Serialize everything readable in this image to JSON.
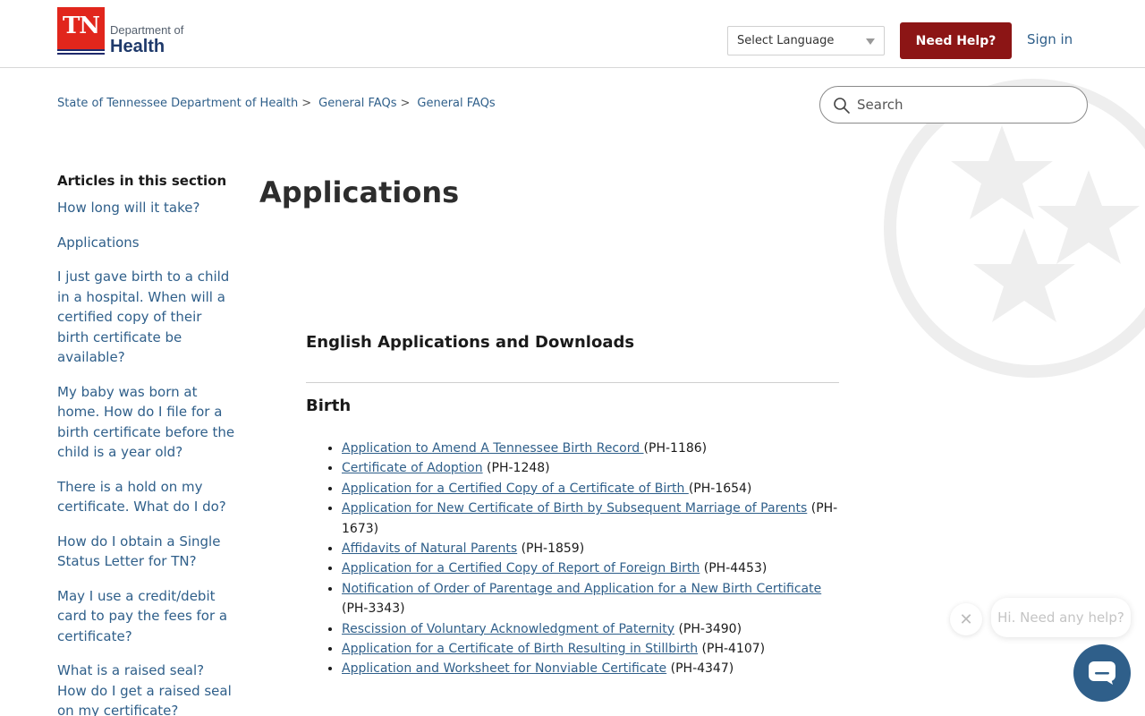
{
  "header": {
    "logo_tn": "TN",
    "logo_dept": "Department of",
    "logo_health": "Health",
    "language_select": "Select Language",
    "need_help": "Need Help?",
    "sign_in": "Sign in"
  },
  "breadcrumb": {
    "items": [
      "State of Tennessee Department of Health",
      "General FAQs",
      "General FAQs"
    ],
    "separator": ">"
  },
  "search": {
    "placeholder": "Search"
  },
  "sidebar": {
    "heading": "Articles in this section",
    "items": [
      "How long will it take?",
      "Applications",
      "I just gave birth to a child in a hospital. When will a certified copy of their birth certificate be available?",
      "My baby was born at home. How do I file for a birth certificate before the child is a year old?",
      "There is a hold on my certificate. What do I do?",
      "How do I obtain a Single Status Letter for TN?",
      "May I use a credit/debit card to pay the fees for a certificate?",
      "What is a raised seal? How do I get a raised seal on my certificate?"
    ]
  },
  "main": {
    "title": "Applications",
    "section_title": "English Applications and Downloads",
    "birth_title": "Birth",
    "applications": [
      {
        "link": "Application to Amend A Tennessee Birth Record ",
        "code": " (PH-1186)"
      },
      {
        "link": "Certificate of Adoption",
        "code": " (PH-1248)"
      },
      {
        "link": "Application for a Certified Copy of a Certificate of Birth ",
        "code": " (PH-1654)"
      },
      {
        "link": "Application for New Certificate of Birth by Subsequent Marriage of Parents",
        "code": " (PH-1673)"
      },
      {
        "link": "Affidavits of Natural Parents",
        "code": " (PH-1859)"
      },
      {
        "link": "Application for a Certified Copy of Report of Foreign Birth",
        "code": " (PH-4453)"
      },
      {
        "link": "Notification of Order of Parentage and Application for a New Birth Certificate",
        "code": " (PH-3343)"
      },
      {
        "link": "Rescission of Voluntary Acknowledgment of Paternity",
        "code": " (PH-3490)"
      },
      {
        "link": "Application for a Certificate of Birth Resulting in Stillbirth",
        "code": " (PH-4107)"
      },
      {
        "link": "Application and Worksheet for Nonviable Certificate",
        "code": " (PH-4347)"
      }
    ]
  },
  "chat": {
    "bubble_text": "Hi. Need any help?",
    "close_icon": "close-icon",
    "launcher_icon": "chat-icon"
  },
  "colors": {
    "brand_red": "#8c1515",
    "link_blue": "#2f5f8a",
    "logo_red": "#e1261c",
    "logo_navy": "#1f2a6b"
  }
}
